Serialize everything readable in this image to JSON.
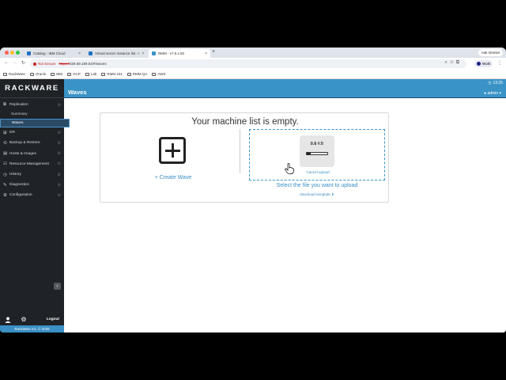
{
  "browser": {
    "tabs": [
      {
        "title": "Catalog - IBM Cloud",
        "active": false
      },
      {
        "title": "Virtual server instance list - I",
        "active": false
      },
      {
        "title": "RMM - v7.5.x.50",
        "active": true
      }
    ],
    "new_tab_label": "+",
    "ask_gemini": "Ask Gemini",
    "address": {
      "not_secure": "Not Secure",
      "url_https": "https://",
      "url_rest": "169.59.189.54/#/waves"
    },
    "profile_label": "Work",
    "bookmarks": [
      "RackWare",
      "Oracle",
      "IBM",
      "GCP",
      "Lab",
      "RMM 231",
      "RMM QA",
      "AWS"
    ]
  },
  "app": {
    "logo": "RACKWARE",
    "clock": "13:25",
    "user": "admin",
    "page_title": "Waves",
    "nav": [
      {
        "label": "Replication",
        "icon": "replication-icon"
      },
      {
        "label": "DR",
        "icon": "dr-icon"
      },
      {
        "label": "Backup & Restore",
        "icon": "backup-icon"
      },
      {
        "label": "Hosts & Images",
        "icon": "hosts-icon"
      },
      {
        "label": "Resource Management",
        "icon": "resource-icon"
      },
      {
        "label": "History",
        "icon": "history-icon"
      },
      {
        "label": "Diagnostics",
        "icon": "wrench-icon"
      },
      {
        "label": "Configuration",
        "icon": "config-icon"
      }
    ],
    "subnav": [
      {
        "label": "Summary"
      },
      {
        "label": "Waves",
        "active": true
      }
    ],
    "logout": "Logout",
    "footer": "RackWare Inc. © 2025",
    "panel": {
      "empty_title": "Your machine list is empty.",
      "create_wave": "+ Create Wave",
      "file_size_value": "0.6",
      "file_size_unit": "KB",
      "upload_progress": 0.2,
      "cancel_upload": "Cancel upload",
      "select_file": "Select the file you want to upload",
      "download_template": "download template"
    }
  },
  "colors": {
    "accent": "#3a93c7",
    "sidebar_bg": "#1f2227",
    "link": "#3a8fc4",
    "not_secure": "#c5221f"
  }
}
